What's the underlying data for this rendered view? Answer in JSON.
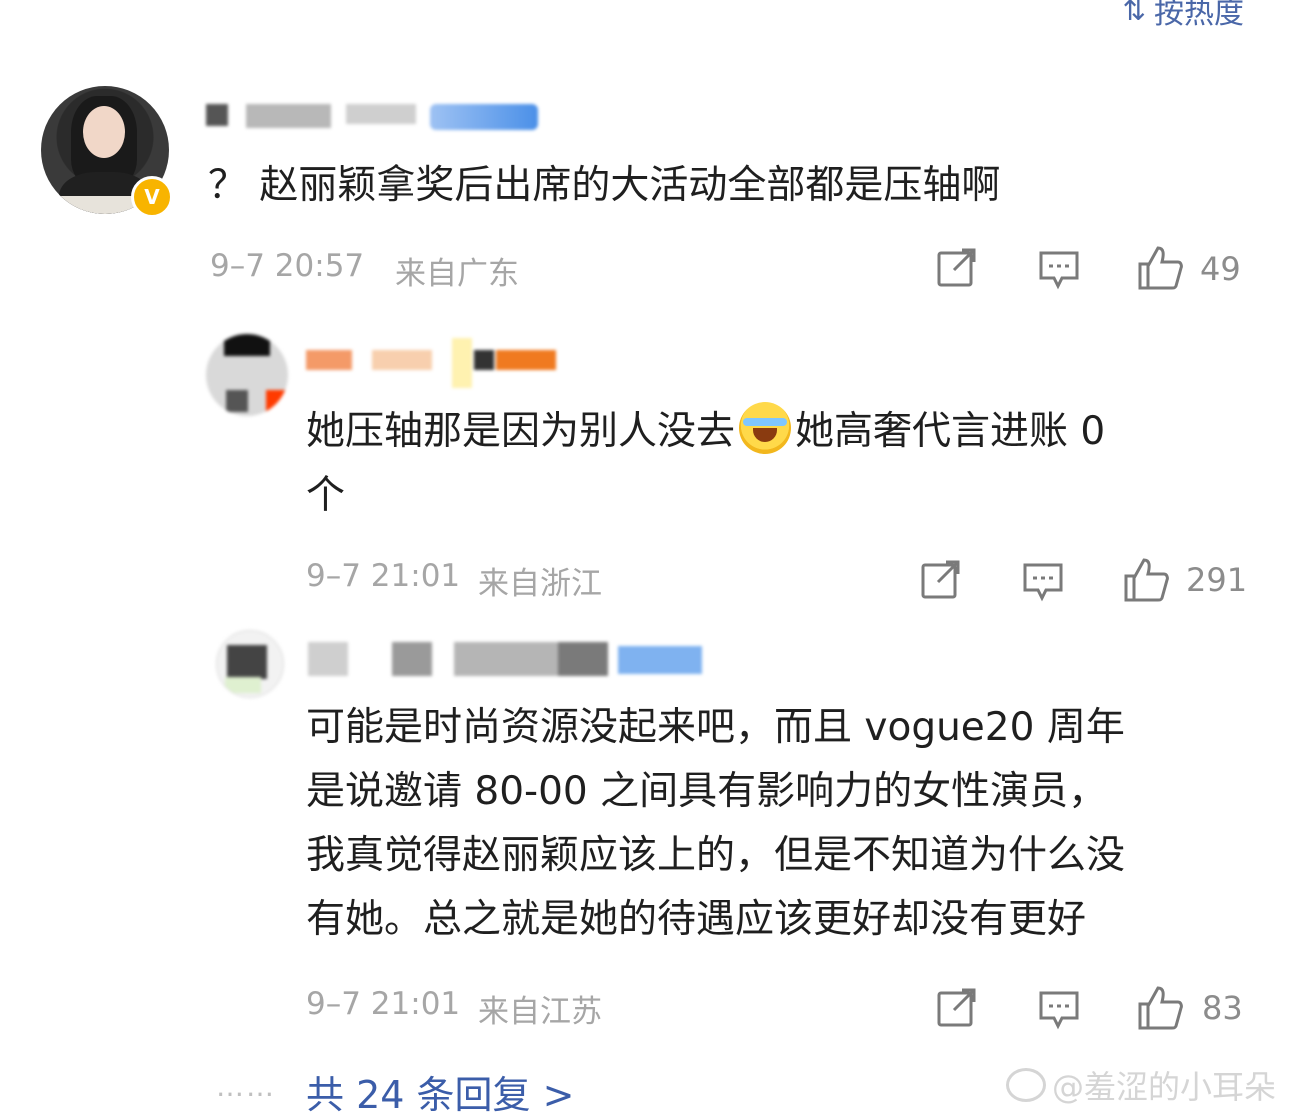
{
  "header": {
    "sort_label": "按热度",
    "sort_icon": "sort-icon"
  },
  "comments": [
    {
      "text": "？  赵丽颖拿奖后出席的大活动全部都是压轴啊",
      "time": "9–7 20:57",
      "location": "来自广东",
      "likes": "49",
      "verified_badge": "V"
    },
    {
      "text_before_emoji": "她压轴那是因为别人没去",
      "text_after_emoji": "她高奢代言进账 0",
      "text_line2": "个",
      "time": "9–7 21:01",
      "location": "来自浙江",
      "likes": "291"
    },
    {
      "lines": [
        "可能是时尚资源没起来吧，而且 vogue20 周年",
        "是说邀请 80-00 之间具有影响力的女性演员，",
        "我真觉得赵丽颖应该上的，但是不知道为什么没",
        "有她。总之就是她的待遇应该更好却没有更好"
      ],
      "time": "9–7 21:01",
      "location": "来自江苏",
      "likes": "83"
    }
  ],
  "footer": {
    "dots": "……",
    "reply_link": "共 24 条回复 >",
    "watermark": "@羞涩的小耳朵"
  },
  "colors": {
    "link": "#3b5da9",
    "meta": "#a6a6a6",
    "badge": "#f8b400"
  }
}
